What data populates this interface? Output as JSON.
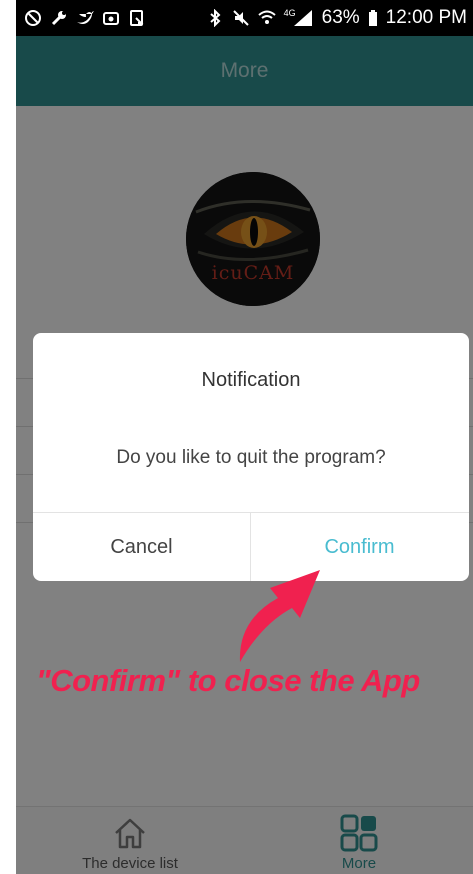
{
  "status_bar": {
    "battery": "63%",
    "time": "12:00 PM",
    "network_badge": "4G",
    "left_icons": [
      "blocked-icon",
      "wrench-icon",
      "twitter-icon",
      "gallery-icon",
      "screenshot-icon"
    ],
    "right_icons": [
      "bluetooth-icon",
      "mute-icon",
      "wifi-icon",
      "signal-icon",
      "battery-icon"
    ]
  },
  "header": {
    "title": "More"
  },
  "profile": {
    "logo_text": "icuCAM"
  },
  "dialog": {
    "title": "Notification",
    "message": "Do you like to quit the program?",
    "cancel_label": "Cancel",
    "confirm_label": "Confirm",
    "confirm_color": "#49bcd0"
  },
  "annotation": {
    "text": "\"Confirm\" to close the App",
    "color": "#f0214f"
  },
  "bottom_nav": {
    "items": [
      {
        "label": "The device list",
        "icon": "home-icon",
        "active": false
      },
      {
        "label": "More",
        "icon": "grid-icon",
        "active": true
      }
    ],
    "accent": "#2f8f8f"
  }
}
